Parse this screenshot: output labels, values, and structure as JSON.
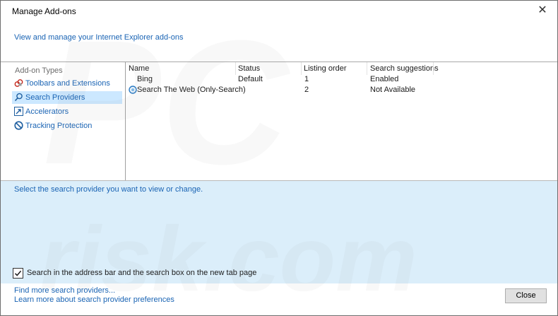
{
  "window": {
    "title": "Manage Add-ons",
    "close_glyph": "✕"
  },
  "subtitle": "View and manage your Internet Explorer add-ons",
  "sidebar": {
    "heading": "Add-on Types",
    "items": [
      {
        "label": "Toolbars and Extensions",
        "icon": "toolbar-extensions-icon",
        "selected": false
      },
      {
        "label": "Search Providers",
        "icon": "search-icon",
        "selected": true
      },
      {
        "label": "Accelerators",
        "icon": "accelerator-icon",
        "selected": false
      },
      {
        "label": "Tracking Protection",
        "icon": "tracking-protection-icon",
        "selected": false
      }
    ]
  },
  "list": {
    "columns": [
      "Name",
      "Status",
      "Listing order",
      "Search suggestions"
    ],
    "rows": [
      {
        "name": "Bing",
        "status": "Default",
        "order": "1",
        "suggestions": "Enabled",
        "icon": ""
      },
      {
        "name": "Search The Web (Only-Search)",
        "status": "",
        "order": "2",
        "suggestions": "Not Available",
        "icon": "provider-icon"
      }
    ]
  },
  "details": {
    "hint": "Select the search provider you want to view or change.",
    "checkbox_label": "Search in the address bar and the search box on the new tab page",
    "checkbox_checked": true
  },
  "footer": {
    "link1": "Find more search providers...",
    "link2": "Learn more about search provider preferences",
    "close_label": "Close"
  },
  "watermark": "PC risk.com",
  "colors": {
    "link": "#1a64b4",
    "selection": "#cce8ff",
    "details_bg": "#dbeefa"
  }
}
